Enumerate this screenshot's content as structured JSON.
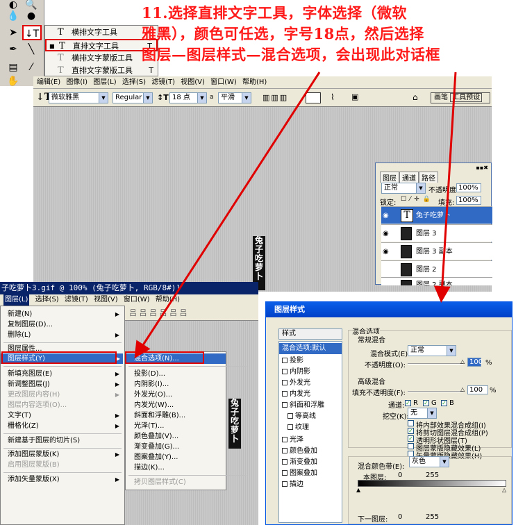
{
  "instruction": {
    "line1": "11.选择直排文字工具，字体选择（微软",
    "line2": "雅黑），颜色可任选，字号18点，然后选择",
    "line3": "图层—图层样式—混合选项，会出现此对话框"
  },
  "flyout": {
    "items": [
      {
        "icon": "T",
        "label": "横排文字工具",
        "key": ""
      },
      {
        "icon": "T",
        "label": "直排文字工具",
        "key": "T"
      },
      {
        "icon": "T",
        "label": "横排文字蒙版工具",
        "key": ""
      },
      {
        "icon": "T",
        "label": "直排文字蒙版工具",
        "key": "T"
      }
    ]
  },
  "app": {
    "menus": [
      "编辑(E)",
      "图像(I)",
      "图层(L)",
      "选择(S)",
      "滤镜(T)",
      "视图(V)",
      "窗口(W)",
      "帮助(H)"
    ],
    "options": {
      "font": "微软雅黑",
      "style": "Regular",
      "size": "18 点",
      "aa_label": "a",
      "aa": "平滑",
      "palette_btn1": "画笔",
      "palette_btn2": "工具预设"
    }
  },
  "canvas_text": "兔子吃萝卜",
  "layers": {
    "tabs": [
      "图层",
      "通道",
      "路径"
    ],
    "blend_mode": "正常",
    "opacity_label": "不透明度:",
    "opacity": "100%",
    "lock_label": "锁定:",
    "fill_label": "填充:",
    "fill": "100%",
    "rows": [
      {
        "name": "兔子吃萝卜",
        "type": "T"
      },
      {
        "name": "图层 3",
        "type": ""
      },
      {
        "name": "图层 3 副本",
        "type": ""
      },
      {
        "name": "图层 2",
        "type": ""
      },
      {
        "name": "图层 2 副本",
        "type": ""
      }
    ]
  },
  "doc": {
    "title": "子吃萝卜3.gif @ 100% (兔子吃萝卜, RGB/8#)]",
    "menus": [
      "图层(L)",
      "选择(S)",
      "滤镜(T)",
      "视图(V)",
      "窗口(W)",
      "帮助(H)"
    ],
    "toolbar_text": "吕 吕 吕   吕 吕 吕"
  },
  "layer_menu": {
    "items": [
      {
        "label": "新建(N)",
        "sub": true,
        "dis": false
      },
      {
        "label": "复制图层(D)...",
        "sub": false,
        "dis": false
      },
      {
        "label": "删除(L)",
        "sub": true,
        "dis": false
      },
      {
        "label": "图层属性...",
        "sub": false,
        "dis": false
      },
      {
        "label": "图层样式(Y)",
        "sub": true,
        "dis": false
      },
      {
        "label": "新填充图层(E)",
        "sub": true,
        "dis": false
      },
      {
        "label": "新调整图层(J)",
        "sub": true,
        "dis": false
      },
      {
        "label": "更改图层内容(H)",
        "sub": true,
        "dis": true
      },
      {
        "label": "图层内容选项(O)...",
        "sub": false,
        "dis": true
      },
      {
        "label": "文字(T)",
        "sub": true,
        "dis": false
      },
      {
        "label": "栅格化(Z)",
        "sub": true,
        "dis": false
      },
      {
        "label": "新建基于图层的切片(S)",
        "sub": false,
        "dis": false
      },
      {
        "label": "添加图层蒙版(K)",
        "sub": true,
        "dis": false
      },
      {
        "label": "启用图层蒙版(B)",
        "sub": false,
        "dis": true
      },
      {
        "label": "添加矢量蒙版(X)",
        "sub": true,
        "dis": false
      }
    ]
  },
  "style_submenu": {
    "items": [
      "混合选项(N)...",
      "投影(D)...",
      "内阴影(I)...",
      "外发光(O)...",
      "内发光(W)...",
      "斜面和浮雕(B)...",
      "光泽(T)...",
      "颜色叠加(V)...",
      "渐变叠加(G)...",
      "图案叠加(Y)...",
      "描边(K)...",
      "拷贝图层样式(C)"
    ]
  },
  "dialog": {
    "title": "图层样式",
    "styles_header": "样式",
    "styles": [
      {
        "label": "混合选项:默认",
        "check": false,
        "indent": false
      },
      {
        "label": "投影",
        "check": true,
        "indent": false
      },
      {
        "label": "内阴影",
        "check": true,
        "indent": false
      },
      {
        "label": "外发光",
        "check": true,
        "indent": false
      },
      {
        "label": "内发光",
        "check": true,
        "indent": false
      },
      {
        "label": "斜面和浮雕",
        "check": true,
        "indent": false
      },
      {
        "label": "等高线",
        "check": true,
        "indent": true
      },
      {
        "label": "纹理",
        "check": true,
        "indent": true
      },
      {
        "label": "光泽",
        "check": true,
        "indent": false
      },
      {
        "label": "颜色叠加",
        "check": true,
        "indent": false
      },
      {
        "label": "渐变叠加",
        "check": true,
        "indent": false
      },
      {
        "label": "图案叠加",
        "check": true,
        "indent": false
      },
      {
        "label": "描边",
        "check": true,
        "indent": false
      }
    ],
    "blend_options": "混合选项",
    "general": "常规混合",
    "mode_label": "混合模式(E):",
    "mode": "正常",
    "opacity_label": "不透明度(O):",
    "opacity": "100",
    "advanced": "高级混合",
    "fill_label": "填充不透明度(F):",
    "fill": "100",
    "channels_label": "通道:",
    "ch_r": "R",
    "ch_g": "G",
    "ch_b": "B",
    "knockout_label": "挖空(K):",
    "knockout": "无",
    "opt1": "将内部效果混合成组(I)",
    "opt2": "将剪切图层混合成组(P)",
    "opt3": "透明形状图层(T)",
    "opt4": "图层蒙版隐藏效果(L)",
    "opt5": "矢量蒙版隐藏效果(H)",
    "blendif_label": "混合颜色带(E):",
    "blendif": "灰色",
    "this_layer": "本图层:",
    "under_layer": "下一图层:",
    "v0": "0",
    "v255": "255",
    "pct": "%"
  },
  "colors": {
    "instruction": "#ff1a1a",
    "highlight": "#316ac5",
    "red_box": "#e00000"
  }
}
